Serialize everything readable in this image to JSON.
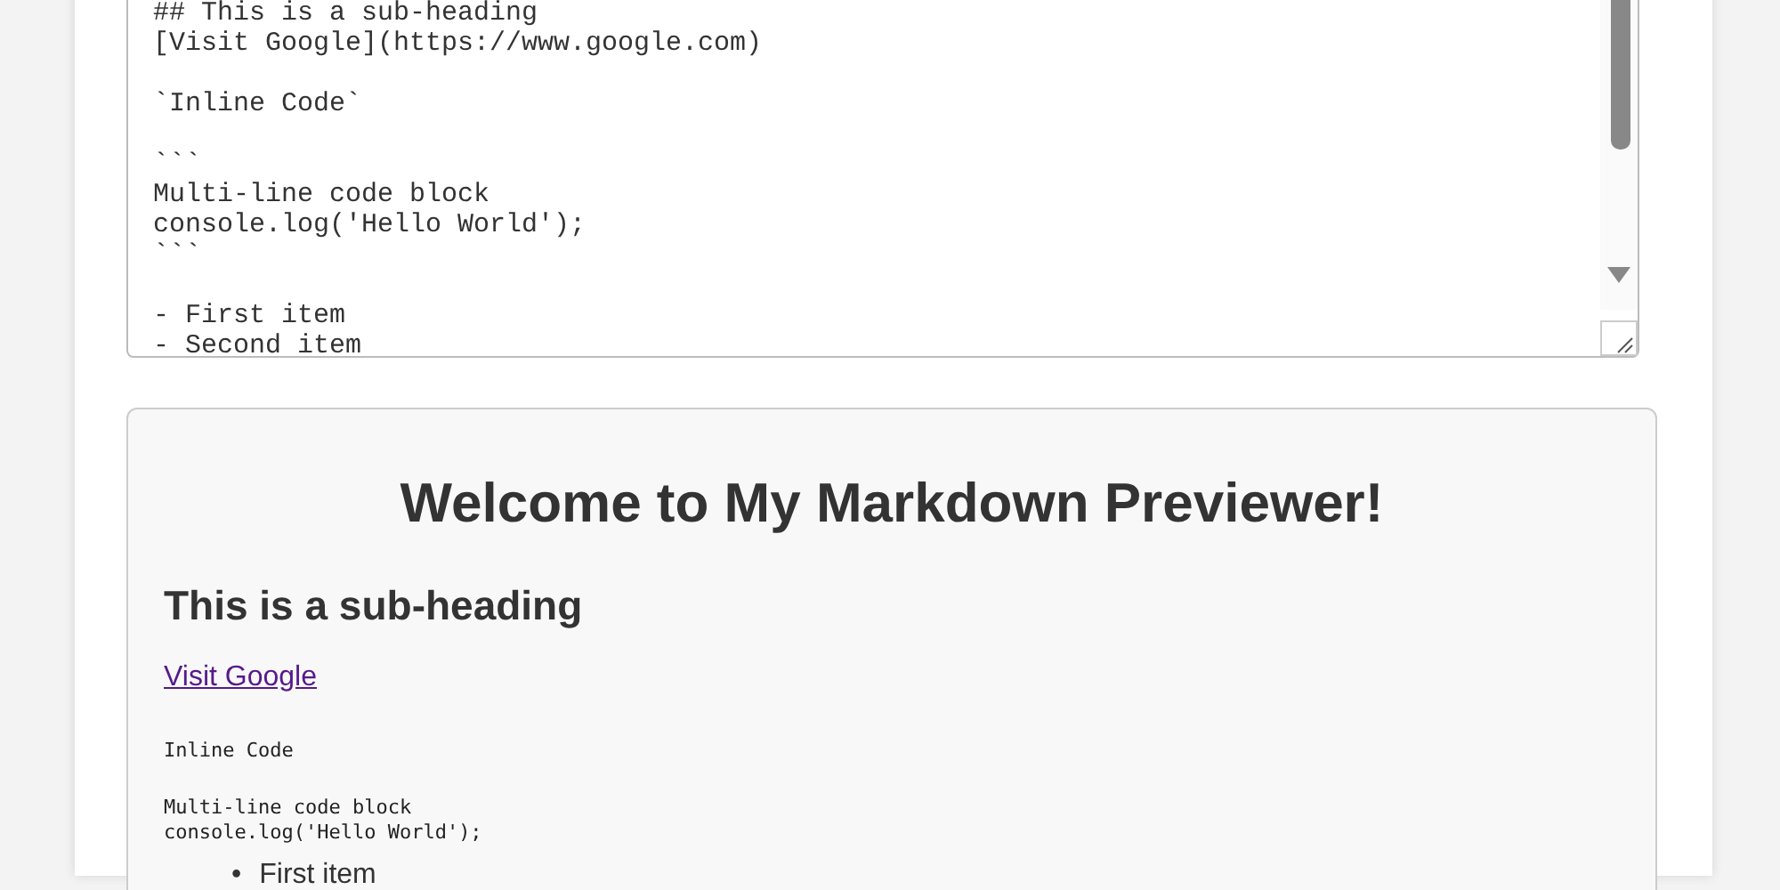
{
  "editor": {
    "value": "## This is a sub-heading\n[Visit Google](https://www.google.com)\n\n`Inline Code`\n\n```\nMulti-line code block\nconsole.log('Hello World');\n```\n\n- First item\n- Second item"
  },
  "preview": {
    "title": "Welcome to My Markdown Previewer!",
    "subheading": "This is a sub-heading",
    "link": {
      "text": "Visit Google",
      "visited": true
    },
    "inline_code": "Inline Code",
    "code_block": "Multi-line code block\nconsole.log('Hello World');",
    "list_items": [
      {
        "marker": "•",
        "text": "First item"
      }
    ]
  }
}
